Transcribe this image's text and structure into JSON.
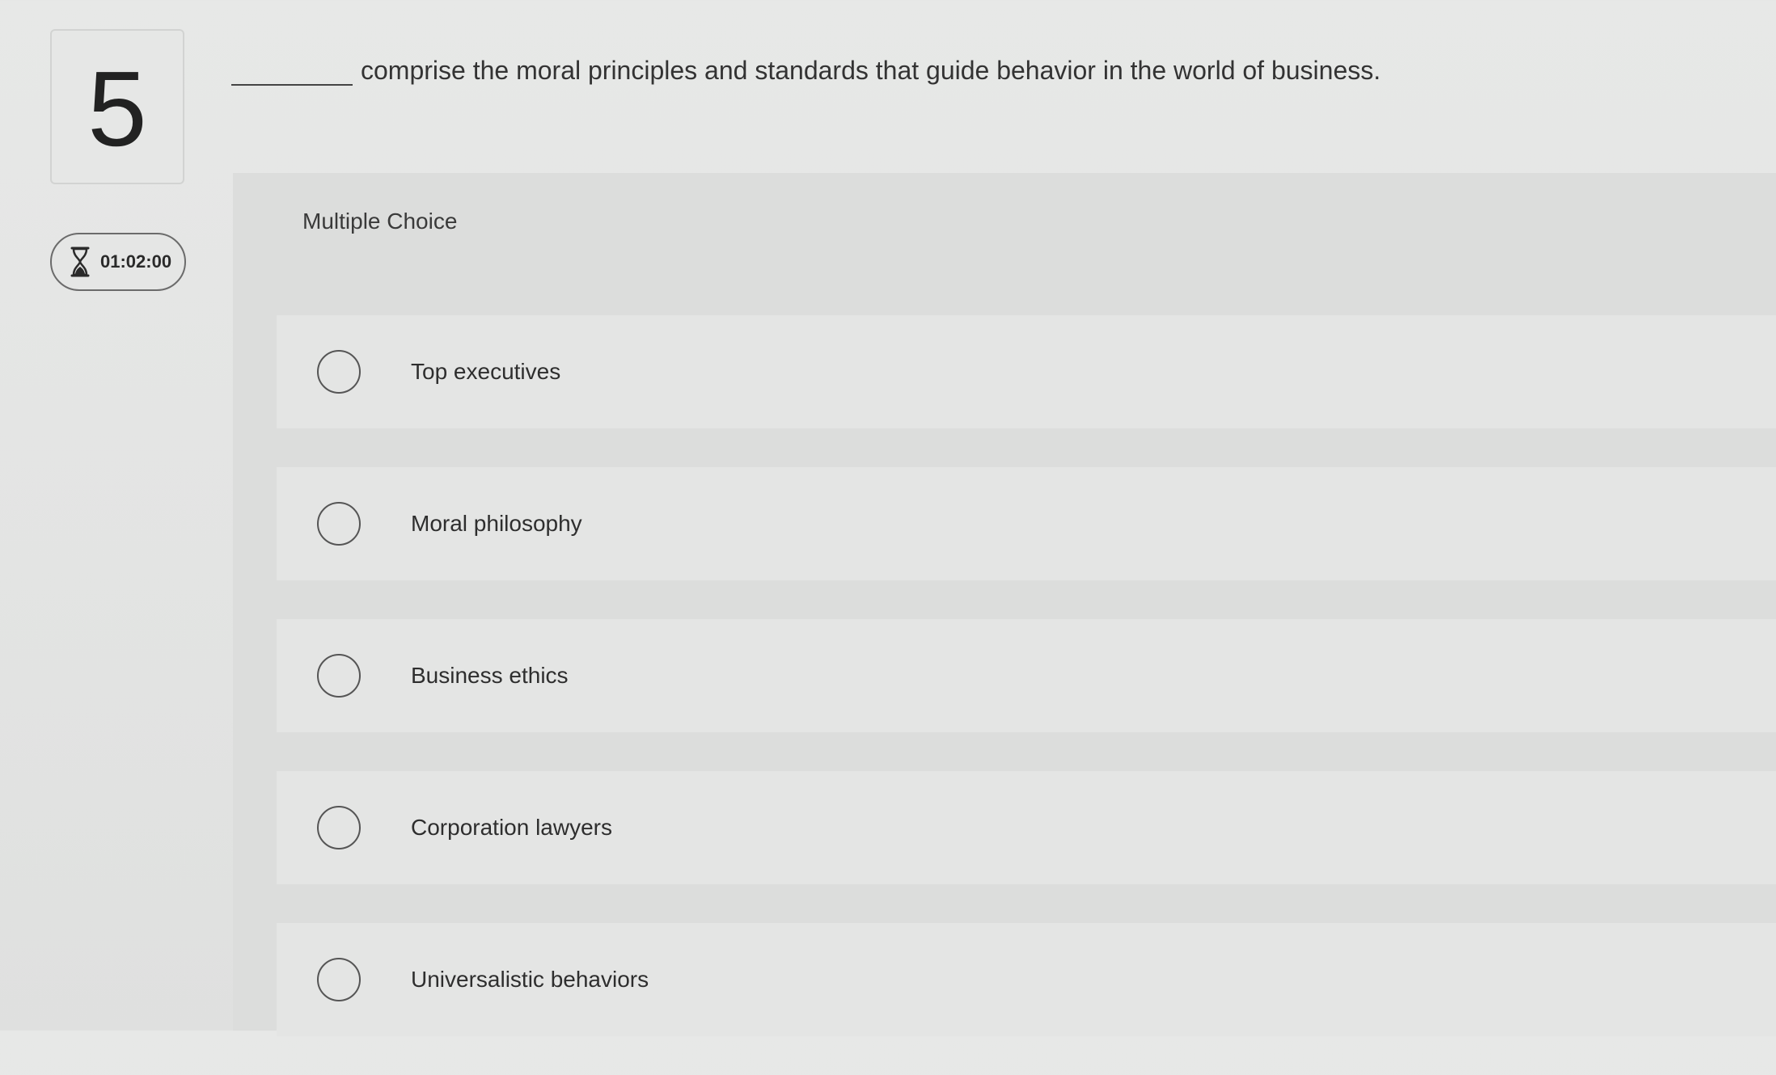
{
  "question": {
    "number": "5",
    "prompt_text": "comprise the moral principles and standards that guide behavior in the world of business.",
    "type_label": "Multiple Choice"
  },
  "timer": {
    "icon": "hourglass-icon",
    "value": "01:02:00"
  },
  "options": [
    {
      "label": "Top executives"
    },
    {
      "label": "Moral philosophy"
    },
    {
      "label": "Business ethics"
    },
    {
      "label": "Corporation lawyers"
    },
    {
      "label": "Universalistic behaviors"
    }
  ]
}
